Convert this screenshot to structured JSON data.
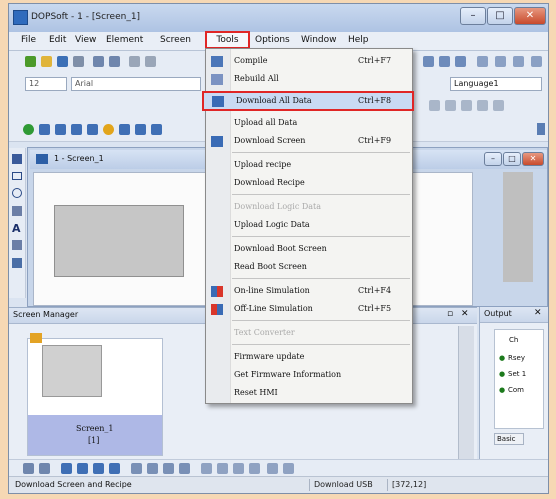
{
  "window": {
    "title": "DOPSoft - 1 - [Screen_1]",
    "min": "–",
    "max": "□",
    "close": "✕"
  },
  "menubar": [
    "File",
    "Edit",
    "View",
    "Element",
    "Screen",
    "Tools",
    "Options",
    "Window",
    "Help"
  ],
  "toolbar": {
    "font_size": "12",
    "font_name": "Arial",
    "language": "Language1"
  },
  "tools_menu": {
    "items": [
      {
        "label": "Compile",
        "shortcut": "Ctrl+F7",
        "icon": "compile-icon",
        "disabled": false
      },
      {
        "label": "Rebuild All",
        "shortcut": "",
        "icon": "rebuild-icon",
        "disabled": false
      },
      {
        "label": "Download All Data",
        "shortcut": "Ctrl+F8",
        "icon": "download-icon",
        "disabled": false,
        "highlighted": true
      },
      {
        "label": "Upload all Data",
        "shortcut": "",
        "icon": "",
        "disabled": false
      },
      {
        "label": "Download Screen",
        "shortcut": "Ctrl+F9",
        "icon": "download-screen-icon",
        "disabled": false
      },
      {
        "label": "Upload recipe",
        "shortcut": "",
        "icon": "",
        "disabled": false
      },
      {
        "label": "Download Recipe",
        "shortcut": "",
        "icon": "",
        "disabled": false
      },
      {
        "label": "Download Logic Data",
        "shortcut": "",
        "icon": "",
        "disabled": true
      },
      {
        "label": "Upload Logic Data",
        "shortcut": "",
        "icon": "",
        "disabled": false
      },
      {
        "label": "Download Boot Screen",
        "shortcut": "",
        "icon": "",
        "disabled": false
      },
      {
        "label": "Read Boot Screen",
        "shortcut": "",
        "icon": "",
        "disabled": false
      },
      {
        "label": "On-line Simulation",
        "shortcut": "Ctrl+F4",
        "icon": "online-sim-icon",
        "disabled": false
      },
      {
        "label": "Off-Line Simulation",
        "shortcut": "Ctrl+F5",
        "icon": "offline-sim-icon",
        "disabled": false
      },
      {
        "label": "Text Converter",
        "shortcut": "",
        "icon": "",
        "disabled": true
      },
      {
        "label": "Firmware update",
        "shortcut": "",
        "icon": "",
        "disabled": false
      },
      {
        "label": "Get Firmware Information",
        "shortcut": "",
        "icon": "",
        "disabled": false
      },
      {
        "label": "Reset HMI",
        "shortcut": "",
        "icon": "",
        "disabled": false
      }
    ]
  },
  "screen_window": {
    "title": "1 - Screen_1"
  },
  "screen_manager": {
    "title": "Screen Manager",
    "thumb_label": "Screen_1",
    "thumb_index": "[1]"
  },
  "output_panel": {
    "title": "Output",
    "items": [
      "Ch",
      "Rsey",
      "Set 1",
      "Com"
    ],
    "basic_label": "Basic"
  },
  "statusbar": {
    "hint": "Download Screen and Recipe",
    "conn": "Download USB",
    "coords": "[372,12]"
  },
  "colors": {
    "highlight_border": "#e02626",
    "menu_bg": "#f4f4f2",
    "page_bg": "#f6d8b4"
  }
}
